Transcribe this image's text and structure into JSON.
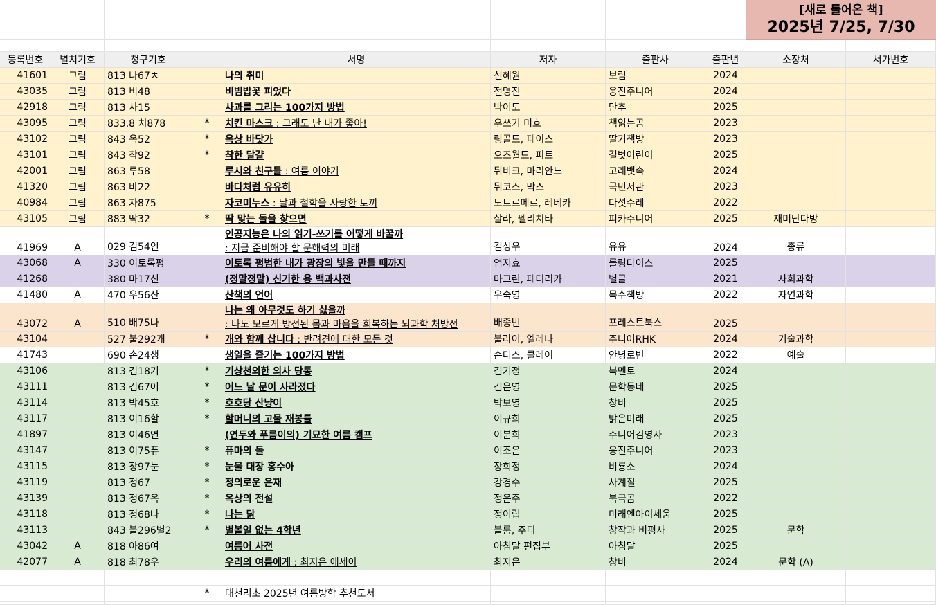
{
  "banner": {
    "line1": "[새로 들어온 책]",
    "line2": "2025년 7/25, 7/30"
  },
  "headers": [
    "등록번호",
    "별치기호",
    "청구기호",
    "",
    "서명",
    "저자",
    "출판사",
    "출판년",
    "소장처",
    "서가번호"
  ],
  "colors": {
    "yellow": "#fff2cc",
    "purple": "#d9d2e9",
    "orange": "#fce5cd",
    "green": "#d9ead3",
    "white": "#ffffff",
    "header": "#efefef",
    "banner": "#e6b8af"
  },
  "rows": [
    {
      "reg": "41601",
      "sep": "그림",
      "call": "813 나67ㅊ",
      "star": "",
      "title": "나의 취미",
      "subtitle": "",
      "author": "신혜원",
      "publisher": "보림",
      "year": "2024",
      "loc": "",
      "shelf": "",
      "color": "yellow"
    },
    {
      "reg": "43035",
      "sep": "그림",
      "call": "813 비48",
      "star": "",
      "title": "비빔밥꽃 피었다",
      "subtitle": "",
      "author": "전명진",
      "publisher": "웅진주니어",
      "year": "2024",
      "loc": "",
      "shelf": "",
      "color": "yellow"
    },
    {
      "reg": "42918",
      "sep": "그림",
      "call": "813 사15",
      "star": "",
      "title": "사과를 그리는 100가지 방법",
      "subtitle": "",
      "author": "박이도",
      "publisher": "단추",
      "year": "2025",
      "loc": "",
      "shelf": "",
      "color": "yellow"
    },
    {
      "reg": "43095",
      "sep": "그림",
      "call": "833.8 치878",
      "star": "*",
      "title": "치킨 마스크",
      "subtitle": " : 그래도 난 내가 좋아!",
      "author": "우쓰기 미호",
      "publisher": "책읽는곰",
      "year": "2023",
      "loc": "",
      "shelf": "",
      "color": "yellow"
    },
    {
      "reg": "43102",
      "sep": "그림",
      "call": "843 옥52",
      "star": "*",
      "title": "옥상 바닷가",
      "subtitle": "",
      "author": "링골드, 페이스",
      "publisher": "딸기책방",
      "year": "2023",
      "loc": "",
      "shelf": "",
      "color": "yellow"
    },
    {
      "reg": "43101",
      "sep": "그림",
      "call": "843 착92",
      "star": "*",
      "title": "착한 달걀",
      "subtitle": "",
      "author": "오즈월드, 피트",
      "publisher": "길벗어린이",
      "year": "2025",
      "loc": "",
      "shelf": "",
      "color": "yellow"
    },
    {
      "reg": "42001",
      "sep": "그림",
      "call": "863 루58",
      "star": "",
      "title": "루시와 친구들",
      "subtitle": " : 여름 이야기",
      "author": "뒤비크, 마리안느",
      "publisher": "고래뱃속",
      "year": "2024",
      "loc": "",
      "shelf": "",
      "color": "yellow"
    },
    {
      "reg": "41320",
      "sep": "그림",
      "call": "863 바22",
      "star": "",
      "title": "바다처럼 유유히",
      "subtitle": "",
      "author": "뒤코스, 막스",
      "publisher": "국민서관",
      "year": "2023",
      "loc": "",
      "shelf": "",
      "color": "yellow"
    },
    {
      "reg": "40984",
      "sep": "그림",
      "call": "863 자875",
      "star": "",
      "title": "자코미누스",
      "subtitle": " : 달과 철학을 사랑한 토끼",
      "author": "도트르메르, 레베카",
      "publisher": "다섯수레",
      "year": "2022",
      "loc": "",
      "shelf": "",
      "color": "yellow"
    },
    {
      "reg": "43105",
      "sep": "그림",
      "call": "883 딱32",
      "star": "*",
      "title": "딱 맞는 돌을 찾으면",
      "subtitle": "",
      "author": "살라, 펠리치타",
      "publisher": "피카주니어",
      "year": "2025",
      "loc": "재미난다방",
      "shelf": "",
      "color": "yellow"
    },
    {
      "reg": "41969",
      "sep": "A",
      "call": "029 김54인",
      "star": "",
      "title": "인공지능은 나의 읽기-쓰기를 어떻게 바꿀까",
      "subtitle": ": 지금 준비해야 할 문해력의 미래",
      "author": "김성우",
      "publisher": "유유",
      "year": "2024",
      "loc": "총류",
      "shelf": "",
      "color": "white",
      "two": true
    },
    {
      "reg": "43068",
      "sep": "A",
      "call": "330 이토록평",
      "star": "",
      "title": "이토록 평범한 내가 광장의 빛을 만들 때까지",
      "subtitle": "",
      "author": "엄지효",
      "publisher": "롤링다이스",
      "year": "2025",
      "loc": "",
      "shelf": "",
      "color": "purple"
    },
    {
      "reg": "41268",
      "sep": "",
      "call": "380 마17신",
      "star": "",
      "title": "(정말정말) 신기한 용 백과사전",
      "subtitle": "",
      "author": "마그린, 페더리카",
      "publisher": "별글",
      "year": "2021",
      "loc": "사회과학",
      "shelf": "",
      "color": "purple"
    },
    {
      "reg": "41480",
      "sep": "A",
      "call": "470 우56산",
      "star": "",
      "title": "산책의 언어",
      "subtitle": "",
      "author": "우숙영",
      "publisher": "목수책방",
      "year": "2022",
      "loc": "자연과학",
      "shelf": "",
      "color": "white"
    },
    {
      "reg": "43072",
      "sep": "A",
      "call": "510 배75나",
      "star": "",
      "title": "나는 왜 아무것도 하기 싫을까",
      "subtitle": " : 나도 모르게 방전된 몸과 마음을 회복하는 뇌과학 처방전",
      "author": "배종빈",
      "publisher": "포레스트북스",
      "year": "2025",
      "loc": "",
      "shelf": "",
      "color": "orange",
      "two": true
    },
    {
      "reg": "43104",
      "sep": "",
      "call": "527 불292개",
      "star": "*",
      "title": "개와 함께 삽니다",
      "subtitle": " : 반려견에 대한 모든 것",
      "author": "불라이, 엘레나",
      "publisher": "주니어RHK",
      "year": "2024",
      "loc": "기술과학",
      "shelf": "",
      "color": "orange"
    },
    {
      "reg": "41743",
      "sep": "",
      "call": "690 손24생",
      "star": "",
      "title": "생일을 즐기는 100가지 방법",
      "subtitle": "",
      "author": "손더스, 클레어",
      "publisher": "안녕로빈",
      "year": "2022",
      "loc": "예술",
      "shelf": "",
      "color": "white"
    },
    {
      "reg": "43106",
      "sep": "",
      "call": "813 김18기",
      "star": "*",
      "title": "기상천외한 의사 당통",
      "subtitle": "",
      "author": "김기정",
      "publisher": "북멘토",
      "year": "2024",
      "loc": "",
      "shelf": "",
      "color": "green"
    },
    {
      "reg": "43111",
      "sep": "",
      "call": "813 김67어",
      "star": "*",
      "title": "어느 날 문이 사라졌다",
      "subtitle": "",
      "author": "김은영",
      "publisher": "문학동네",
      "year": "2025",
      "loc": "",
      "shelf": "",
      "color": "green"
    },
    {
      "reg": "43114",
      "sep": "",
      "call": "813 박45호",
      "star": "*",
      "title": "호호당 산냥이",
      "subtitle": "",
      "author": "박보영",
      "publisher": "창비",
      "year": "2025",
      "loc": "",
      "shelf": "",
      "color": "green"
    },
    {
      "reg": "43117",
      "sep": "",
      "call": "813 이16할",
      "star": "*",
      "title": "할머니의 고물 재봉틀",
      "subtitle": "",
      "author": "이규희",
      "publisher": "밝은미래",
      "year": "2025",
      "loc": "",
      "shelf": "",
      "color": "green"
    },
    {
      "reg": "41897",
      "sep": "",
      "call": "813 이46연",
      "star": "",
      "title": "(연두와 푸름이의) 기묘한 여름 캠프",
      "subtitle": "",
      "author": "이분희",
      "publisher": "주니어김영사",
      "year": "2023",
      "loc": "",
      "shelf": "",
      "color": "green"
    },
    {
      "reg": "43147",
      "sep": "",
      "call": "813 이75퓨",
      "star": "*",
      "title": "퓨마의 돌",
      "subtitle": "",
      "author": "이조은",
      "publisher": "웅진주니어",
      "year": "2023",
      "loc": "",
      "shelf": "",
      "color": "green"
    },
    {
      "reg": "43115",
      "sep": "",
      "call": "813 장97눈",
      "star": "*",
      "title": "눈물 대장 홍수아",
      "subtitle": "",
      "author": "장희정",
      "publisher": "비룡소",
      "year": "2024",
      "loc": "",
      "shelf": "",
      "color": "green"
    },
    {
      "reg": "43119",
      "sep": "",
      "call": "813 정67",
      "star": "*",
      "title": "정의로운 은재",
      "subtitle": "",
      "author": "강경수",
      "publisher": "사계절",
      "year": "2025",
      "loc": "",
      "shelf": "",
      "color": "green"
    },
    {
      "reg": "43139",
      "sep": "",
      "call": "813 정67옥",
      "star": "*",
      "title": "옥상의 전설",
      "subtitle": "",
      "author": "정은주",
      "publisher": "북극곰",
      "year": "2022",
      "loc": "",
      "shelf": "",
      "color": "green"
    },
    {
      "reg": "43118",
      "sep": "",
      "call": "813 정68나",
      "star": "*",
      "title": "나는 닭",
      "subtitle": "",
      "author": "정이립",
      "publisher": "미래엔아이세움",
      "year": "2025",
      "loc": "",
      "shelf": "",
      "color": "green"
    },
    {
      "reg": "43113",
      "sep": "",
      "call": "843 블296별2",
      "star": "*",
      "title": "별볼일 없는 4학년",
      "subtitle": "",
      "author": "블룸, 주디",
      "publisher": "창작과 비평사",
      "year": "2025",
      "loc": "문학",
      "shelf": "",
      "color": "green"
    },
    {
      "reg": "43042",
      "sep": "A",
      "call": "818 아86여",
      "star": "",
      "title": "여름어 사전",
      "subtitle": "",
      "author": "아침달 편집부",
      "publisher": "아침달",
      "year": "2025",
      "loc": "",
      "shelf": "",
      "color": "green"
    },
    {
      "reg": "42077",
      "sep": "A",
      "call": "818 최78우",
      "star": "",
      "title": "우리의 여름에게",
      "subtitle": " : 최지은 에세이",
      "author": "최지은",
      "publisher": "창비",
      "year": "2024",
      "loc": "문학 (A)",
      "shelf": "",
      "color": "green"
    }
  ],
  "footnote": {
    "star": "*",
    "text": "대천리초 2025년 여름방학 추천도서"
  }
}
